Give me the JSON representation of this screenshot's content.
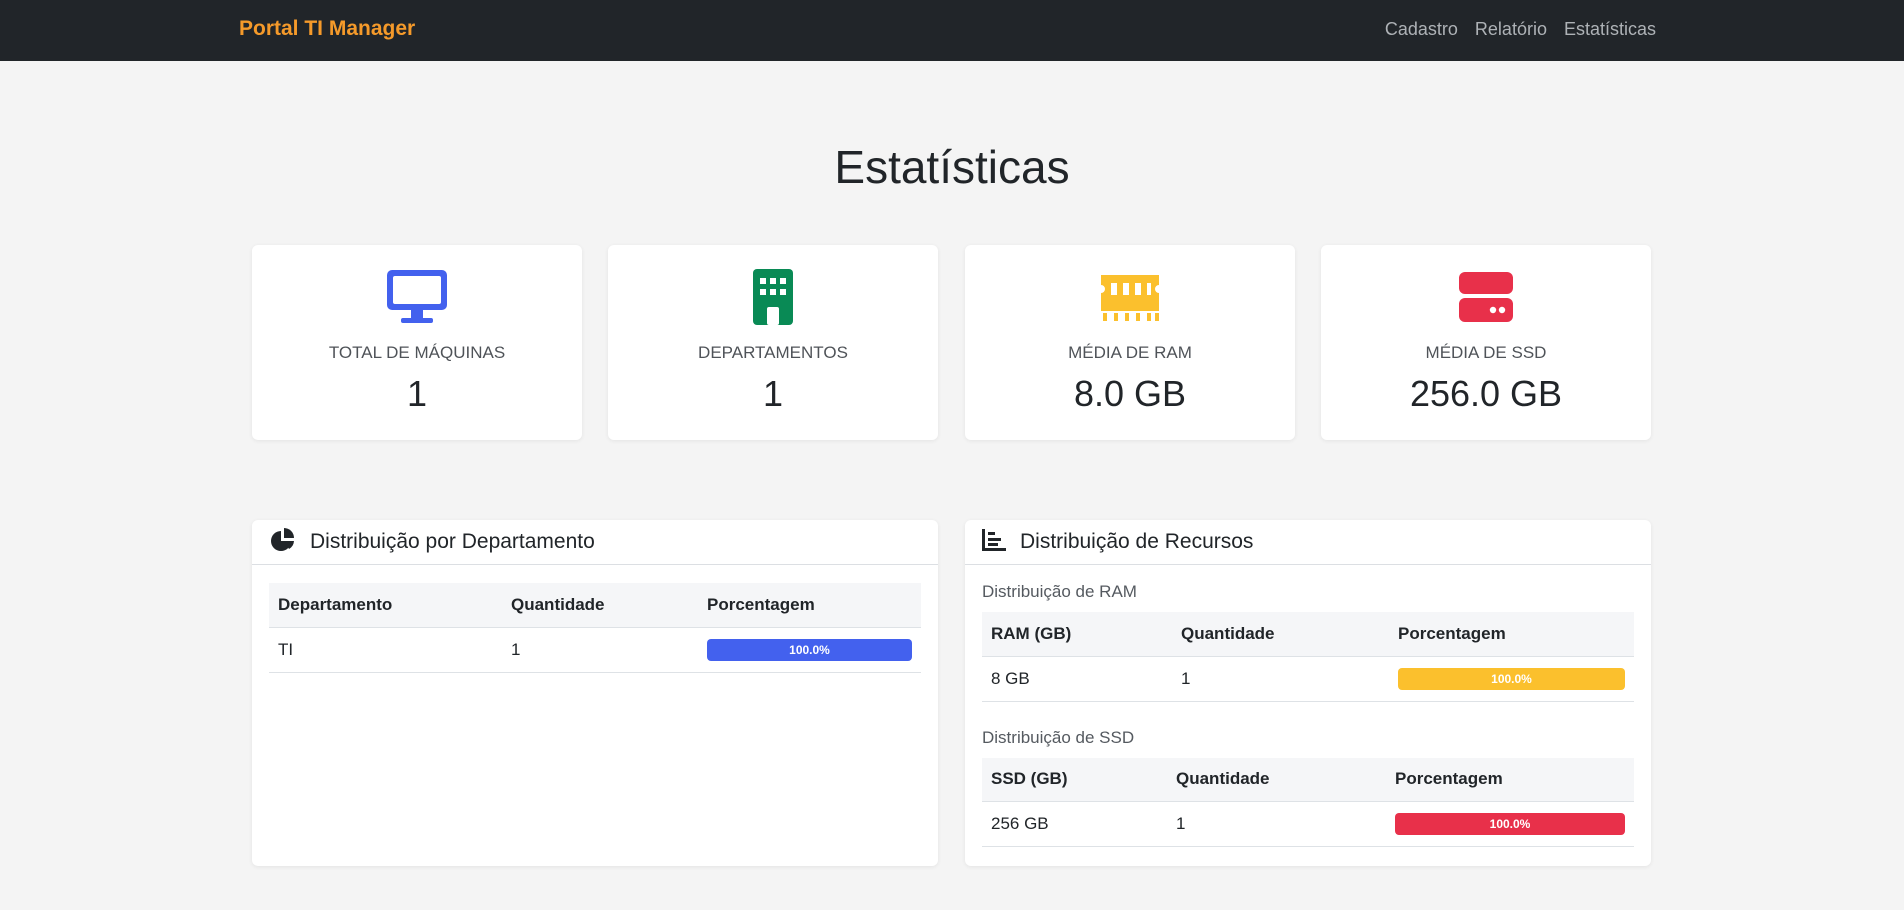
{
  "navbar": {
    "brand": "Portal TI Manager",
    "links": [
      "Cadastro",
      "Relatório",
      "Estatísticas"
    ]
  },
  "page": {
    "title": "Estatísticas"
  },
  "stats": [
    {
      "icon": "desktop-icon",
      "label": "Total de Máquinas",
      "value": "1",
      "color": "#4361ee"
    },
    {
      "icon": "building-icon",
      "label": "Departamentos",
      "value": "1",
      "color": "#098a55"
    },
    {
      "icon": "memory-icon",
      "label": "Média de RAM",
      "value": "8.0 GB",
      "color": "#fbc02d"
    },
    {
      "icon": "hdd-icon",
      "label": "Média de SSD",
      "value": "256.0 GB",
      "color": "#e8304a"
    }
  ],
  "department_panel": {
    "icon": "pie-chart-icon",
    "title": "Distribuição por Departamento",
    "headers": [
      "Departamento",
      "Quantidade",
      "Porcentagem"
    ],
    "rows": [
      {
        "name": "TI",
        "count": "1",
        "percent": "100.0%",
        "fraction": 1.0
      }
    ],
    "bar_color": "#4361ee"
  },
  "resources_panel": {
    "icon": "bar-chart-icon",
    "title": "Distribuição de Recursos",
    "ram": {
      "subtitle": "Distribuição de RAM",
      "headers": [
        "RAM (GB)",
        "Quantidade",
        "Porcentagem"
      ],
      "rows": [
        {
          "name": "8 GB",
          "count": "1",
          "percent": "100.0%",
          "fraction": 1.0
        }
      ],
      "bar_color": "#fbc02d"
    },
    "ssd": {
      "subtitle": "Distribuição de SSD",
      "headers": [
        "SSD (GB)",
        "Quantidade",
        "Porcentagem"
      ],
      "rows": [
        {
          "name": "256 GB",
          "count": "1",
          "percent": "100.0%",
          "fraction": 1.0
        }
      ],
      "bar_color": "#e8304a"
    }
  }
}
